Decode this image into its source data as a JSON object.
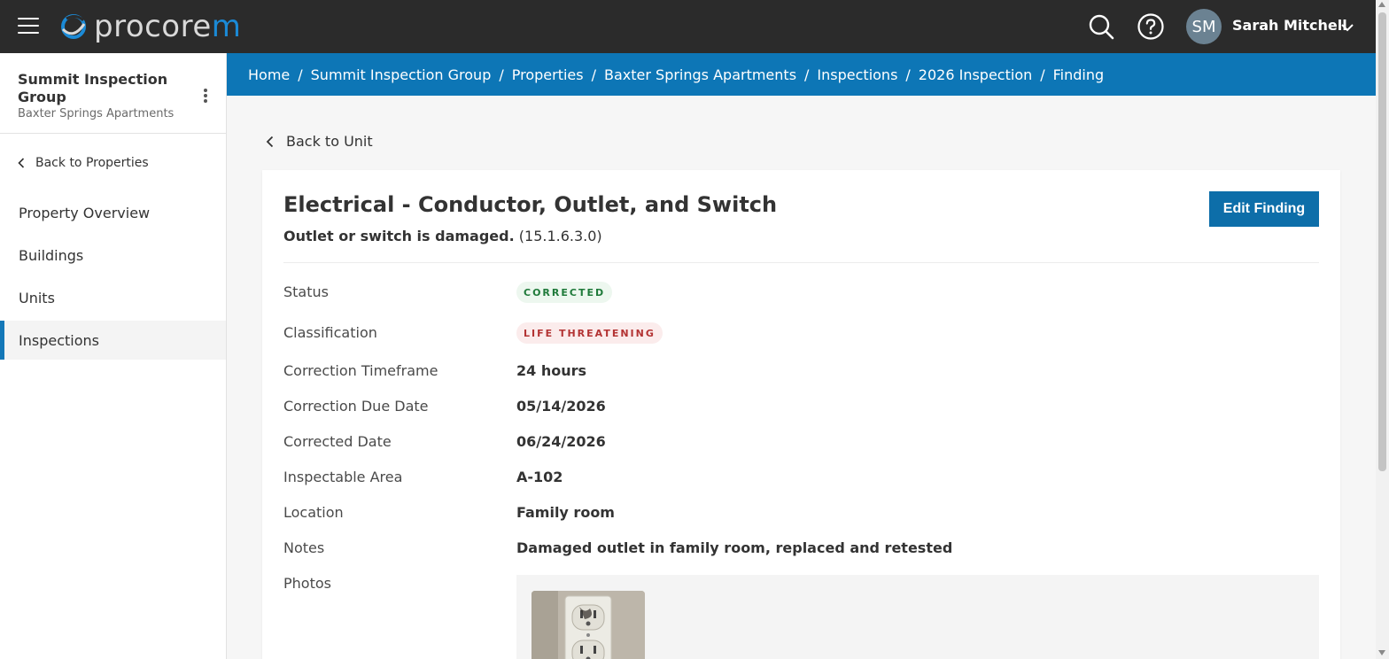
{
  "header": {
    "logo_prefix": "procore",
    "logo_suffix": "m",
    "user_initials": "SM",
    "user_name": "Sarah Mitchell"
  },
  "sidebar": {
    "org_name": "Summit Inspection Group",
    "property_name": "Baxter Springs Apartments",
    "back_label": "Back to Properties",
    "items": [
      {
        "label": "Property Overview",
        "active": false
      },
      {
        "label": "Buildings",
        "active": false
      },
      {
        "label": "Units",
        "active": false
      },
      {
        "label": "Inspections",
        "active": true
      }
    ]
  },
  "breadcrumb": [
    "Home",
    "Summit Inspection Group",
    "Properties",
    "Baxter Springs Apartments",
    "Inspections",
    "2026 Inspection",
    "Finding"
  ],
  "main": {
    "back_label": "Back to Unit",
    "title": "Electrical - Conductor, Outlet, and Switch",
    "subtitle_bold": "Outlet or switch is damaged.",
    "subtitle_code": "(15.1.6.3.0)",
    "edit_label": "Edit Finding",
    "fields": {
      "status_label": "Status",
      "status_value": "CORRECTED",
      "classification_label": "Classification",
      "classification_value": "LIFE THREATENING",
      "timeframe_label": "Correction Timeframe",
      "timeframe_value": "24 hours",
      "due_label": "Correction Due Date",
      "due_value": "05/14/2026",
      "corrected_label": "Corrected Date",
      "corrected_value": "06/24/2026",
      "area_label": "Inspectable Area",
      "area_value": "A-102",
      "location_label": "Location",
      "location_value": "Family room",
      "notes_label": "Notes",
      "notes_value": "Damaged outlet in family room, replaced and retested",
      "photos_label": "Photos"
    }
  },
  "colors": {
    "topbar": "#2b2b2b",
    "breadcrumb_bar": "#0d76b6",
    "primary_button": "#0d6ea9",
    "active_indicator": "#1478b8",
    "status_green": "#1f7a3a",
    "status_red": "#b33333"
  }
}
